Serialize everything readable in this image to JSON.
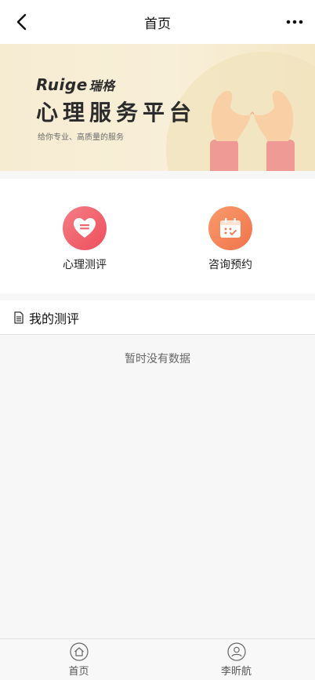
{
  "nav": {
    "title": "首页",
    "back_icon": "chevron-left-icon",
    "more_icon": "ellipsis-icon"
  },
  "banner": {
    "brand_latin": "Ruige",
    "brand_cn": "瑞格",
    "headline": "心理服务平台",
    "subtitle": "给你专业、高质量的服务"
  },
  "services": [
    {
      "label": "心理测评",
      "icon": "heart-icon",
      "color": "#f0626c"
    },
    {
      "label": "咨询预约",
      "icon": "calendar-icon",
      "color": "#f5825a"
    }
  ],
  "section": {
    "title": "我的测评",
    "icon": "document-icon"
  },
  "empty_text": "暂时没有数据",
  "tabbar": [
    {
      "label": "首页",
      "icon": "home-icon"
    },
    {
      "label": "李昕航",
      "icon": "user-icon"
    }
  ]
}
